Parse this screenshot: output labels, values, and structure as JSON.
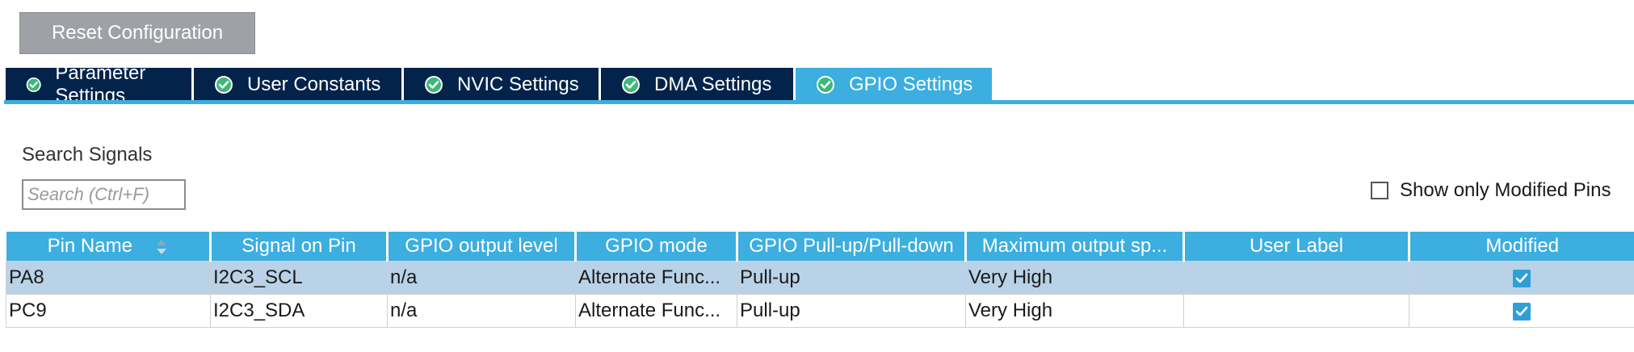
{
  "toolbar": {
    "reset_label": "Reset Configuration"
  },
  "tabs": [
    {
      "label": "Parameter Settings",
      "active": false
    },
    {
      "label": "User Constants",
      "active": false
    },
    {
      "label": "NVIC Settings",
      "active": false
    },
    {
      "label": "DMA Settings",
      "active": false
    },
    {
      "label": "GPIO Settings",
      "active": true
    }
  ],
  "search": {
    "label": "Search Signals",
    "placeholder": "Search (Ctrl+F)",
    "value": ""
  },
  "filter": {
    "show_modified_label": "Show only Modified Pins",
    "checked": false
  },
  "table": {
    "columns": [
      "Pin Name",
      "Signal on Pin",
      "GPIO output level",
      "GPIO mode",
      "GPIO Pull-up/Pull-down",
      "Maximum output sp...",
      "User Label",
      "Modified"
    ],
    "sort_column": "Pin Name",
    "rows": [
      {
        "pin": "PA8",
        "signal": "I2C3_SCL",
        "output_level": "n/a",
        "mode": "Alternate Func...",
        "pull": "Pull-up",
        "speed": "Very High",
        "label": "",
        "modified": true,
        "selected": true
      },
      {
        "pin": "PC9",
        "signal": "I2C3_SDA",
        "output_level": "n/a",
        "mode": "Alternate Func...",
        "pull": "Pull-up",
        "speed": "Very High",
        "label": "",
        "modified": true,
        "selected": false
      }
    ]
  },
  "colors": {
    "tab_inactive": "#03234b",
    "tab_active": "#3caee0",
    "header": "#3caee0",
    "selected_row": "#b9d2e8",
    "check_green": "#3cb878",
    "checkbox_blue": "#2f9fd8",
    "reset_button": "#9ea2a6"
  },
  "icons": {
    "tab_status": "check-circle-icon",
    "sort": "sort-arrows-icon",
    "modified": "checkbox-checked-icon"
  }
}
